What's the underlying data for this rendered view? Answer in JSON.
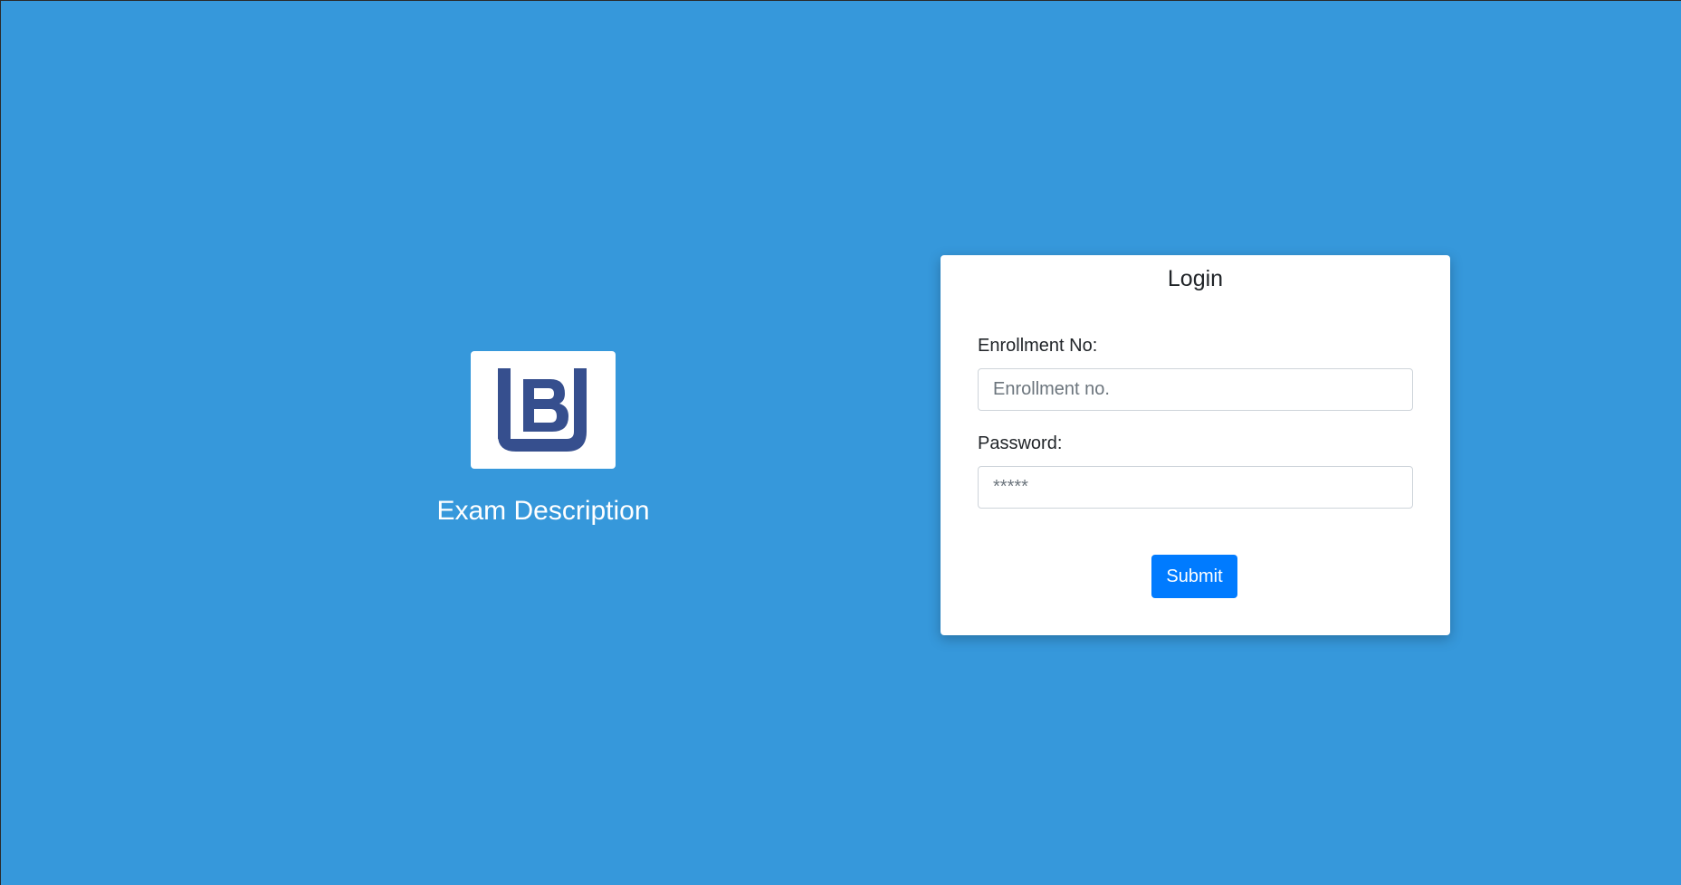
{
  "brand": {
    "logo_icon": "lbu-logo-icon",
    "logo_color": "#364f8e",
    "exam_description": "Exam Description"
  },
  "login": {
    "title": "Login",
    "enrollment_label": "Enrollment No:",
    "enrollment_placeholder": "Enrollment no.",
    "enrollment_value": "",
    "password_label": "Password:",
    "password_placeholder": "*****",
    "password_value": "",
    "submit_label": "Submit"
  },
  "colors": {
    "background": "#3698db",
    "card": "#ffffff",
    "primary_button": "#007bff"
  }
}
